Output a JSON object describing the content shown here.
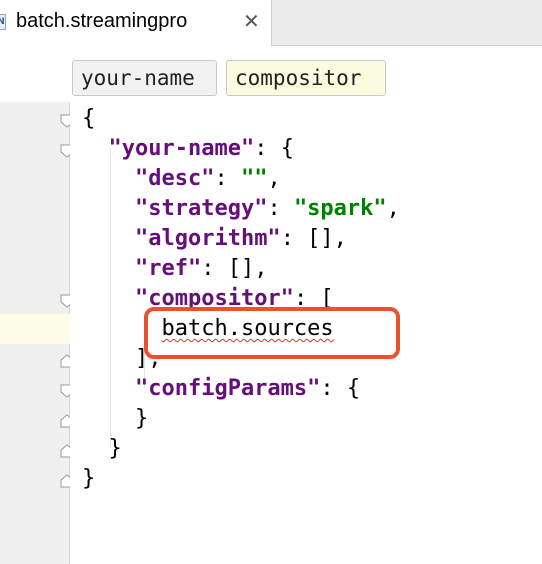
{
  "tab": {
    "icon_letter": "N",
    "title": "batch.streamingpro",
    "close_glyph": "✕"
  },
  "breadcrumbs": [
    "your-name",
    "compositor"
  ],
  "code": {
    "lines": [
      "{",
      "  \"your-name\": {",
      "    \"desc\": \"\",",
      "    \"strategy\": \"spark\",",
      "    \"algorithm\": [],",
      "    \"ref\": [],",
      "    \"compositor\": [",
      "      batch.sources",
      "    ],",
      "    \"configParams\": {",
      "    }",
      "  }",
      "}"
    ],
    "tokens": {
      "l0": "{",
      "l1_key": "\"your-name\"",
      "l1_rest": ": {",
      "l2_key": "\"desc\"",
      "l2_mid": ": ",
      "l2_val": "\"\"",
      "l2_end": ",",
      "l3_key": "\"strategy\"",
      "l3_mid": ": ",
      "l3_val": "\"spark\"",
      "l3_end": ",",
      "l4_key": "\"algorithm\"",
      "l4_rest": ": [],",
      "l5_key": "\"ref\"",
      "l5_rest": ": [],",
      "l6_key": "\"compositor\"",
      "l6_rest": ": [",
      "l7": "batch.sources",
      "l8": "],",
      "l9_key": "\"configParams\"",
      "l9_rest": ": {",
      "l10": "}",
      "l11": "}",
      "l12": "}"
    },
    "highlighted_line": 7,
    "error_underline_line": 7
  },
  "colors": {
    "key": "#660e7a",
    "string": "#008000",
    "highlight_box": "#e8532f",
    "current_line": "#fefde8"
  }
}
